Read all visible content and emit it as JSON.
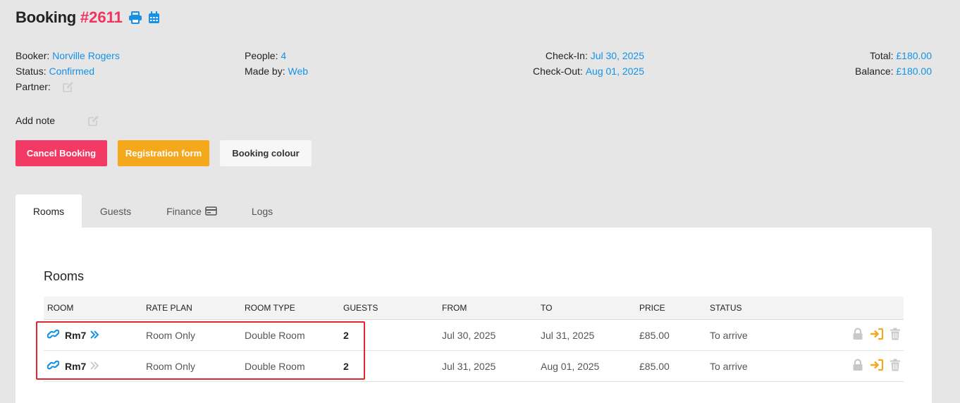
{
  "header": {
    "title": "Booking",
    "booking_number": "#2611",
    "icons": [
      "print-icon",
      "calendar-icon"
    ]
  },
  "info": {
    "booker_label": "Booker:",
    "booker": "Norville Rogers",
    "status_label": "Status:",
    "status": "Confirmed",
    "partner_label": "Partner:",
    "people_label": "People:",
    "people": "4",
    "made_by_label": "Made by:",
    "made_by": "Web",
    "checkin_label": "Check-In:",
    "checkin": "Jul 30, 2025",
    "checkout_label": "Check-Out:",
    "checkout": "Aug 01, 2025",
    "total_label": "Total:",
    "total": "£180.00",
    "balance_label": "Balance:",
    "balance": "£180.00"
  },
  "note": {
    "label": "Add note"
  },
  "buttons": {
    "cancel": "Cancel Booking",
    "registration": "Registration form",
    "colour": "Booking colour"
  },
  "tabs": [
    {
      "label": "Rooms",
      "active": true
    },
    {
      "label": "Guests"
    },
    {
      "label": "Finance",
      "icon": "credit-card-icon"
    },
    {
      "label": "Logs"
    }
  ],
  "rooms": {
    "heading": "Rooms",
    "columns": [
      "ROOM",
      "RATE PLAN",
      "ROOM TYPE",
      "GUESTS",
      "FROM",
      "TO",
      "PRICE",
      "STATUS"
    ],
    "rows": [
      {
        "room": "Rm7",
        "rate_plan": "Room Only",
        "room_type": "Double Room",
        "guests": "2",
        "from": "Jul 30, 2025",
        "to": "Jul 31, 2025",
        "price": "£85.00",
        "status": "To arrive"
      },
      {
        "room": "Rm7",
        "rate_plan": "Room Only",
        "room_type": "Double Room",
        "guests": "2",
        "from": "Jul 31, 2025",
        "to": "Aug 01, 2025",
        "price": "£85.00",
        "status": "To arrive"
      }
    ]
  },
  "colors": {
    "accent_blue": "#1592e6",
    "booking_number": "#f0345e",
    "cancel_button": "#f33a64",
    "registration_button": "#f5a81c",
    "highlight_box": "#e0262f"
  }
}
